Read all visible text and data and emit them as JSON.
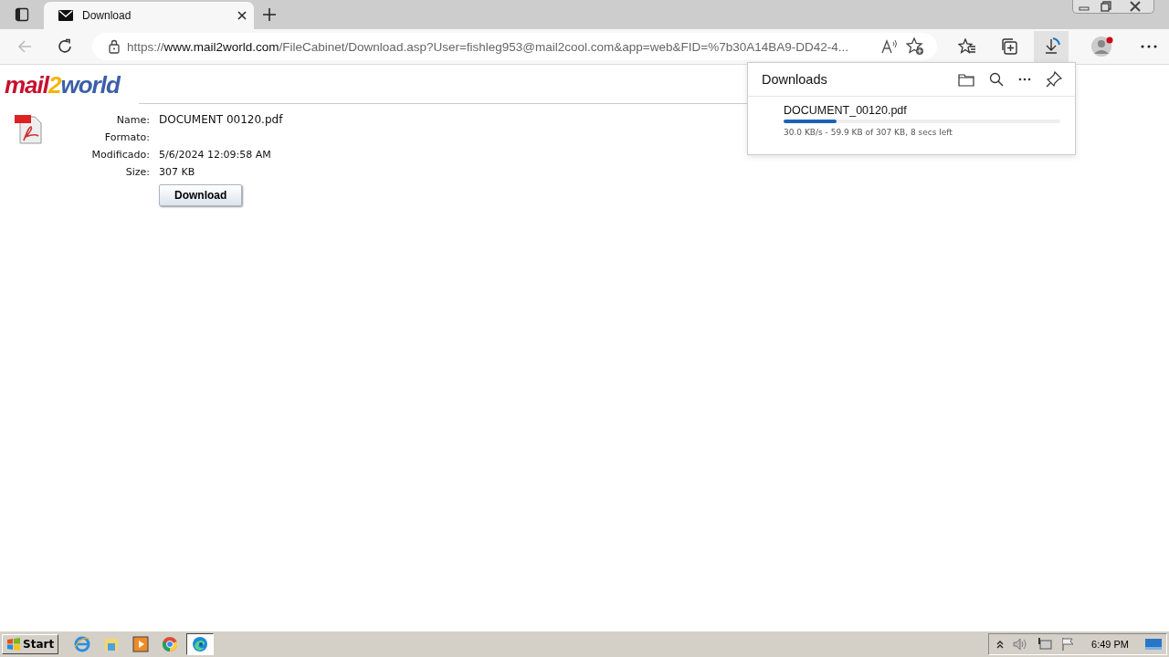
{
  "tab": {
    "title": "Download",
    "selected": true
  },
  "address": {
    "scheme": "https://",
    "host": "www.mail2world.com",
    "rest": "/FileCabinet/Download.asp?User=fishleg953@mail2cool.com&app=web&FID=%7b30A14BA9-DD42-4..."
  },
  "logo": {
    "part1": "mail",
    "part2": "2",
    "part3": "world"
  },
  "file": {
    "fields": [
      {
        "label": "Name:",
        "value": "DOCUMENT 00120.pdf"
      },
      {
        "label": "Formato:"
      },
      {
        "label": "Modificado:",
        "value": "5/6/2024 12:09:58 AM"
      },
      {
        "label": "Size:",
        "value": "307 KB"
      }
    ],
    "button": "Download"
  },
  "downloads_panel": {
    "title": "Downloads",
    "items": [
      {
        "name": "DOCUMENT_00120.pdf",
        "level": 0.19,
        "status": "30.0 KB/s - 59.9 KB of 307 KB, 8 secs left"
      }
    ]
  },
  "taskbar": {
    "start": "Start",
    "apps": [
      {
        "kind": "ie",
        "selected": false
      },
      {
        "kind": "explorer",
        "selected": false
      },
      {
        "kind": "media",
        "selected": false
      },
      {
        "kind": "chrome",
        "selected": false
      },
      {
        "kind": "edge",
        "selected": true
      }
    ],
    "clock": "6:49 PM"
  }
}
